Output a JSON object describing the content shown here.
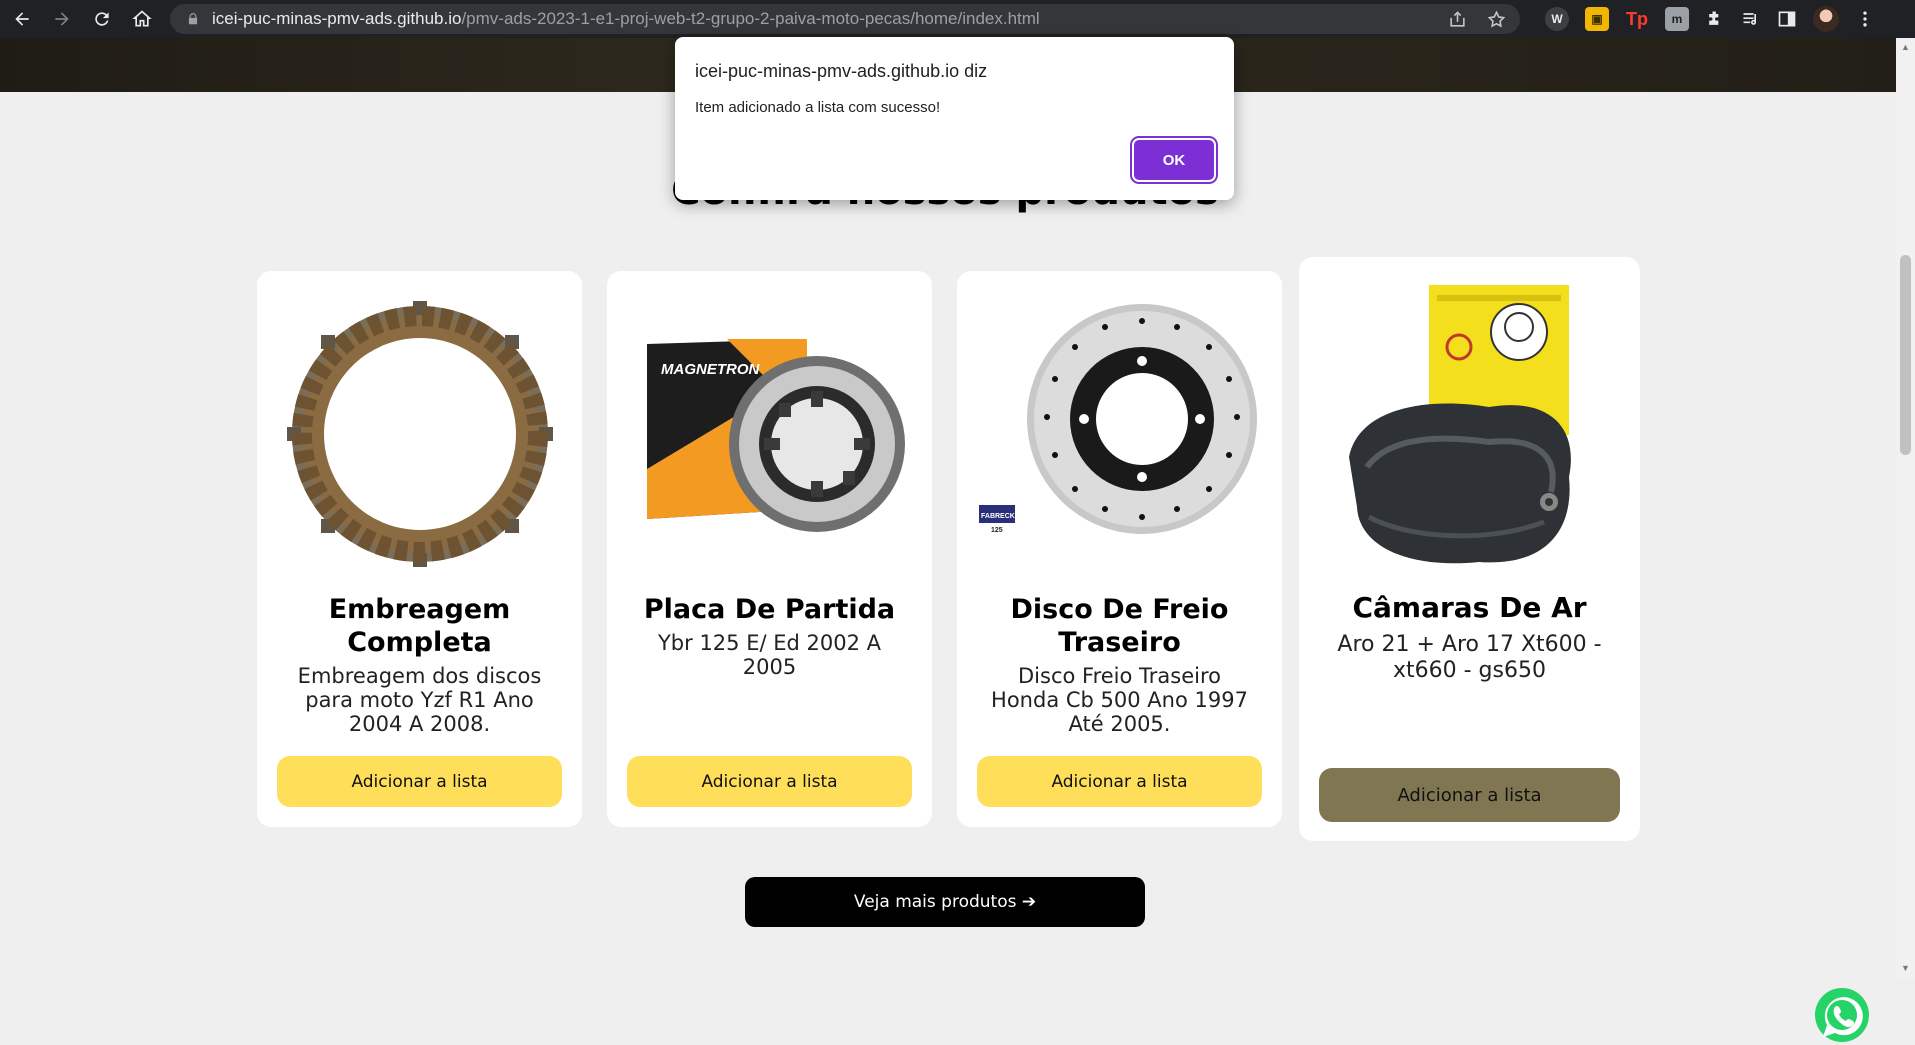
{
  "browser": {
    "url_host": "icei-puc-minas-pmv-ads.github.io",
    "url_path": "/pmv-ads-2023-1-e1-proj-web-t2-grupo-2-paiva-moto-pecas/home/index.html"
  },
  "dialog": {
    "title": "icei-puc-minas-pmv-ads.github.io diz",
    "message": "Item adicionado a lista com sucesso!",
    "ok_label": "OK"
  },
  "section": {
    "title": "Confira nossos produtos"
  },
  "products": [
    {
      "name": "Embreagem Completa",
      "description": "Embreagem dos discos para moto Yzf R1 Ano 2004 A 2008.",
      "button_label": "Adicionar a lista"
    },
    {
      "name": "Placa De Partida",
      "description": "Ybr 125 E/ Ed 2002 A 2005",
      "button_label": "Adicionar a lista"
    },
    {
      "name": "Disco De Freio Traseiro",
      "description": "Disco Freio Traseiro Honda Cb 500 Ano 1997 Até 2005.",
      "button_label": "Adicionar a lista"
    },
    {
      "name": "Câmaras De Ar",
      "description": "Aro 21 + Aro 17 Xt600 - xt660 - gs650",
      "button_label": "Adicionar a lista"
    }
  ],
  "product_images": {
    "brand_text": "MAGNETRON",
    "disc_logo": "FABRECK",
    "disc_logo_num": "125"
  },
  "more_button": {
    "label": "Veja mais produtos ➔"
  },
  "colors": {
    "button_yellow": "#ffde59",
    "button_hover": "#807651",
    "dialog_ok": "#7b2fd4",
    "whatsapp_green": "#25d366"
  },
  "icons": [
    "back-icon",
    "forward-icon",
    "reload-icon",
    "home-icon",
    "lock-icon",
    "share-icon",
    "star-icon",
    "extensions-icon",
    "whatsapp-icon"
  ]
}
